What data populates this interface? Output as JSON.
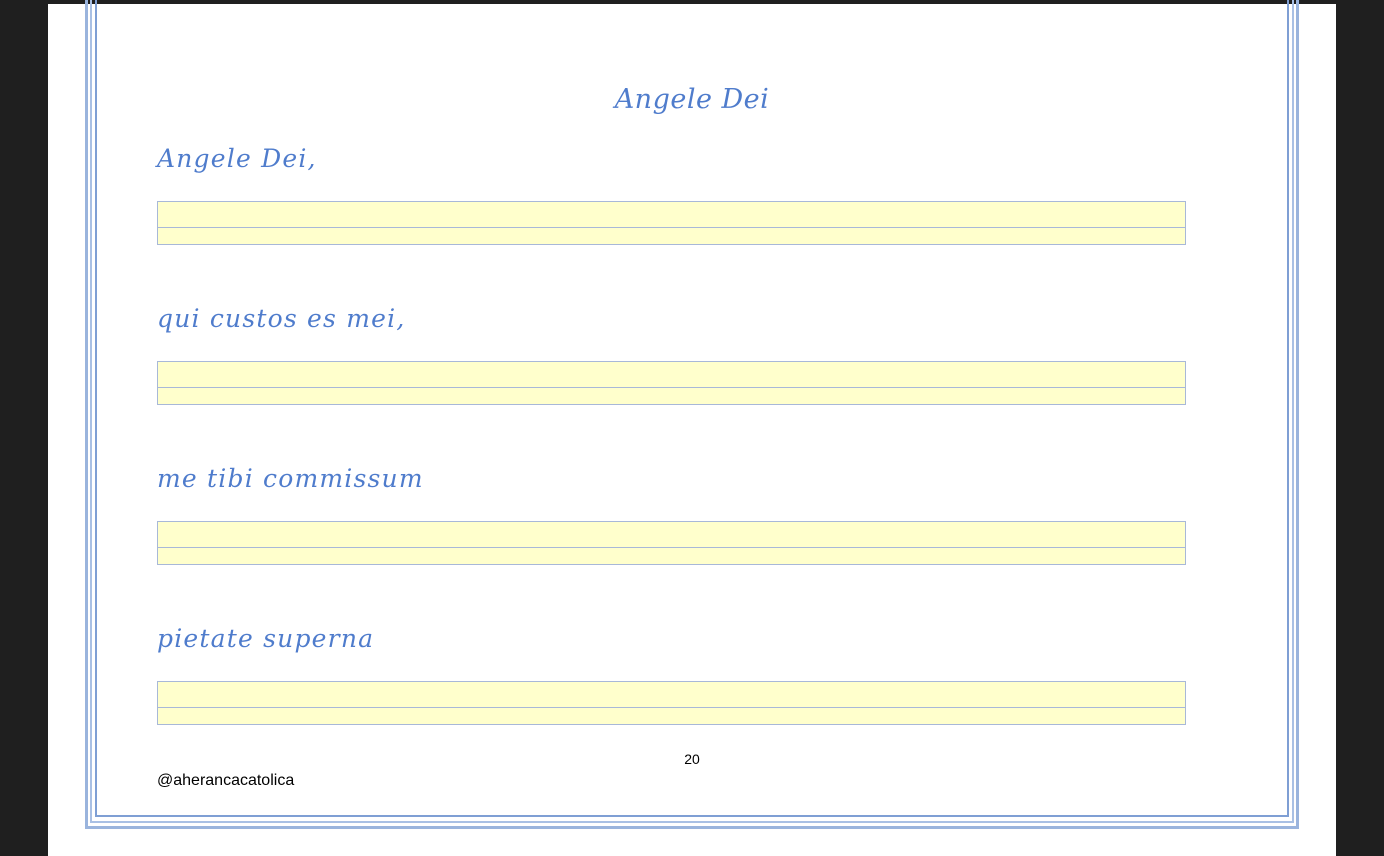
{
  "document": {
    "title": "Angele Dei",
    "lines": [
      {
        "model_text": "Angele Dei,"
      },
      {
        "model_text": "qui custos es mei,"
      },
      {
        "model_text": "me tibi commissum"
      },
      {
        "model_text": "pietate superna"
      }
    ],
    "page_number": "20",
    "footer_handle": "@aherancacatolica"
  },
  "colors": {
    "script_blue": "#4f7ccc",
    "writing_band": "#ffffcc",
    "frame_blue": "#9ab4dd",
    "background": "#1f1f1f"
  }
}
